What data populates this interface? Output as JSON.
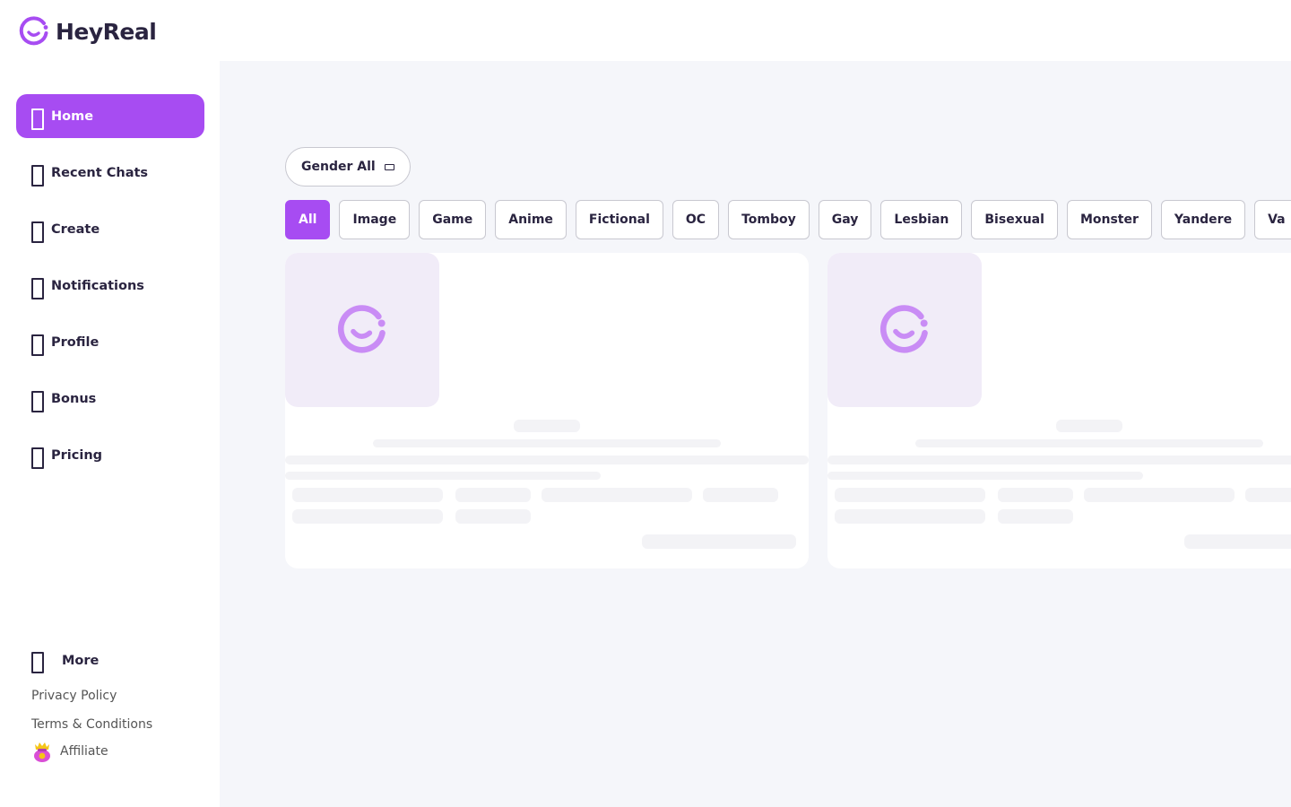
{
  "brand": {
    "name": "HeyReal",
    "color": "#a74cf2"
  },
  "sidebar": {
    "items": [
      {
        "label": "Home",
        "active": true
      },
      {
        "label": "Recent Chats",
        "active": false
      },
      {
        "label": "Create",
        "active": false
      },
      {
        "label": "Notifications",
        "active": false
      },
      {
        "label": "Profile",
        "active": false
      },
      {
        "label": "Bonus",
        "active": false
      },
      {
        "label": "Pricing",
        "active": false
      }
    ],
    "more_label": "More",
    "privacy_label": "Privacy Policy",
    "terms_label": "Terms & Conditions",
    "affiliate_label": "Affiliate"
  },
  "filters": {
    "gender_label": "Gender All",
    "tags": [
      "All",
      "Image",
      "Game",
      "Anime",
      "Fictional",
      "OC",
      "Tomboy",
      "Gay",
      "Lesbian",
      "Bisexual",
      "Monster",
      "Yandere",
      "Va"
    ],
    "active_tag": "All"
  },
  "colors": {
    "accent": "#a74cf2",
    "main_bg": "#f5f6fa",
    "placeholder_bg": "#f1ecf8",
    "placeholder_logo": "#c98cf5"
  }
}
